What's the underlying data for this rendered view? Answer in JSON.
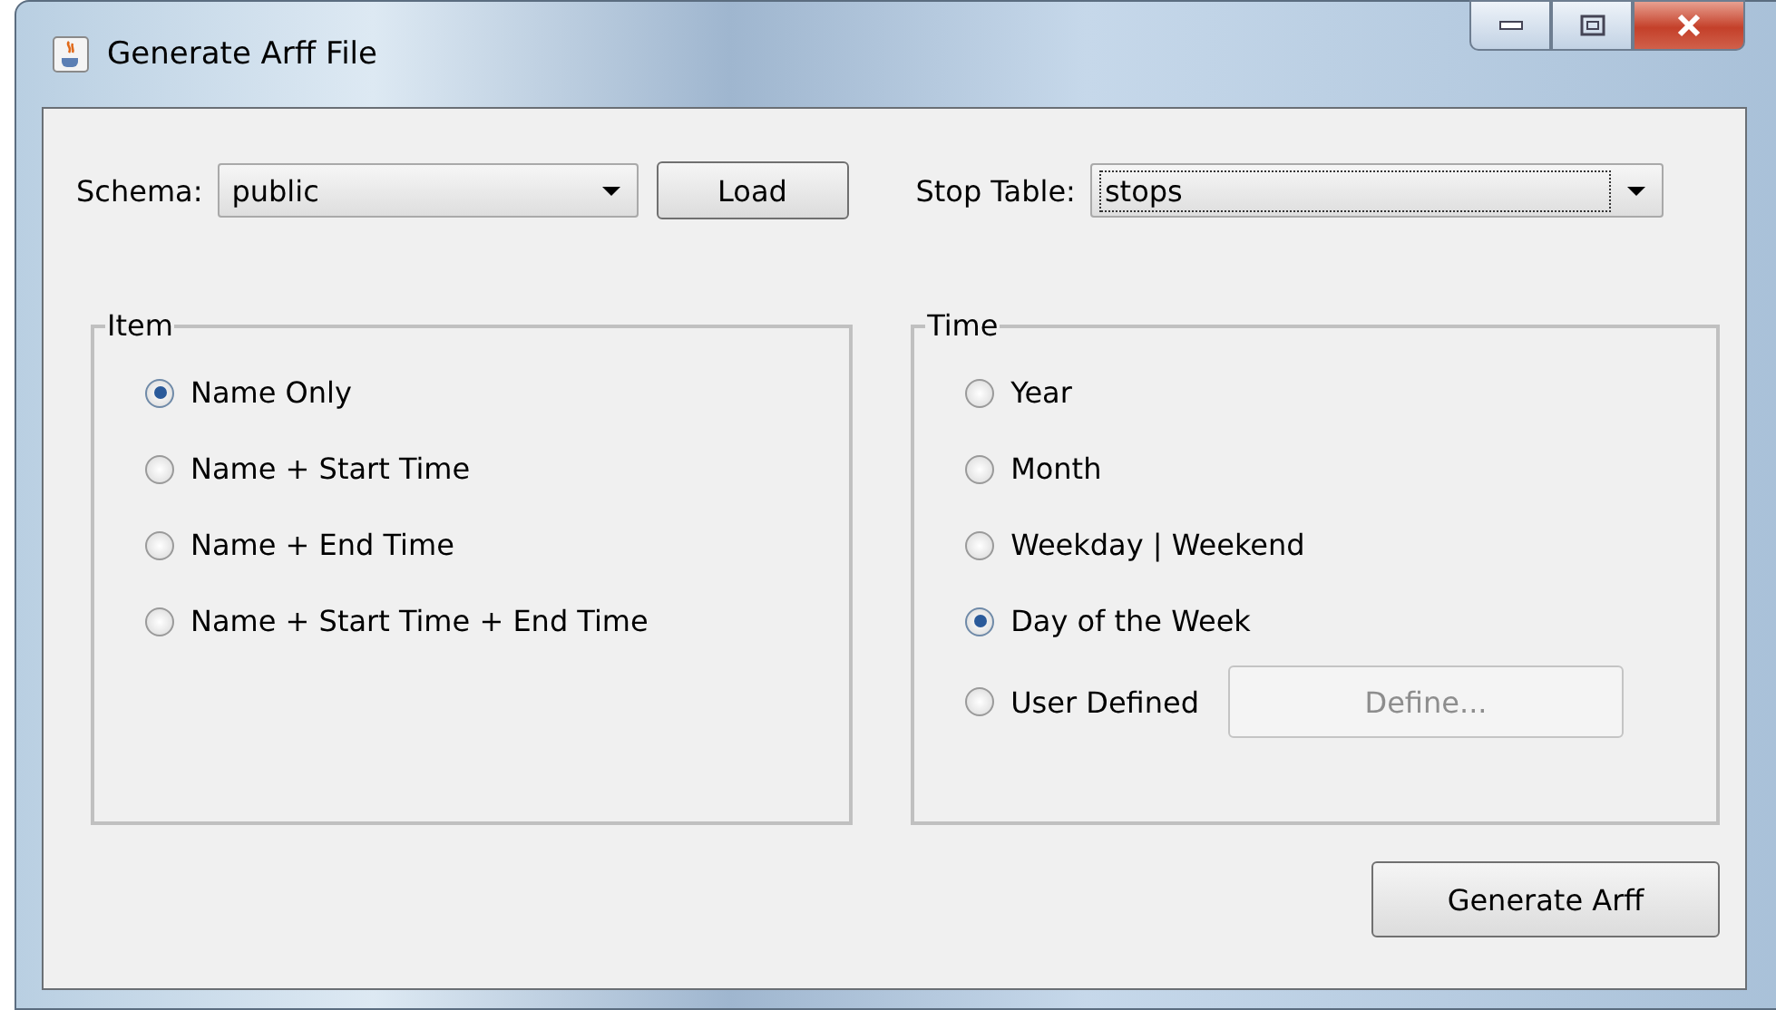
{
  "window": {
    "title": "Generate Arff File"
  },
  "schema": {
    "label": "Schema:",
    "value": "public"
  },
  "load_button": {
    "label": "Load"
  },
  "stop_table": {
    "label": "Stop Table:",
    "value": "stops",
    "focused": true
  },
  "item_group": {
    "title": "Item",
    "options": [
      {
        "label": "Name Only",
        "selected": true
      },
      {
        "label": "Name + Start Time",
        "selected": false
      },
      {
        "label": "Name + End Time",
        "selected": false
      },
      {
        "label": "Name + Start Time + End Time",
        "selected": false
      }
    ]
  },
  "time_group": {
    "title": "Time",
    "options": [
      {
        "label": "Year",
        "selected": false
      },
      {
        "label": "Month",
        "selected": false
      },
      {
        "label": "Weekday | Weekend",
        "selected": false
      },
      {
        "label": "Day of the Week",
        "selected": true
      },
      {
        "label": "User Defined",
        "selected": false
      }
    ]
  },
  "define_button": {
    "label": "Define...",
    "disabled": true
  },
  "generate_button": {
    "label": "Generate Arff"
  }
}
